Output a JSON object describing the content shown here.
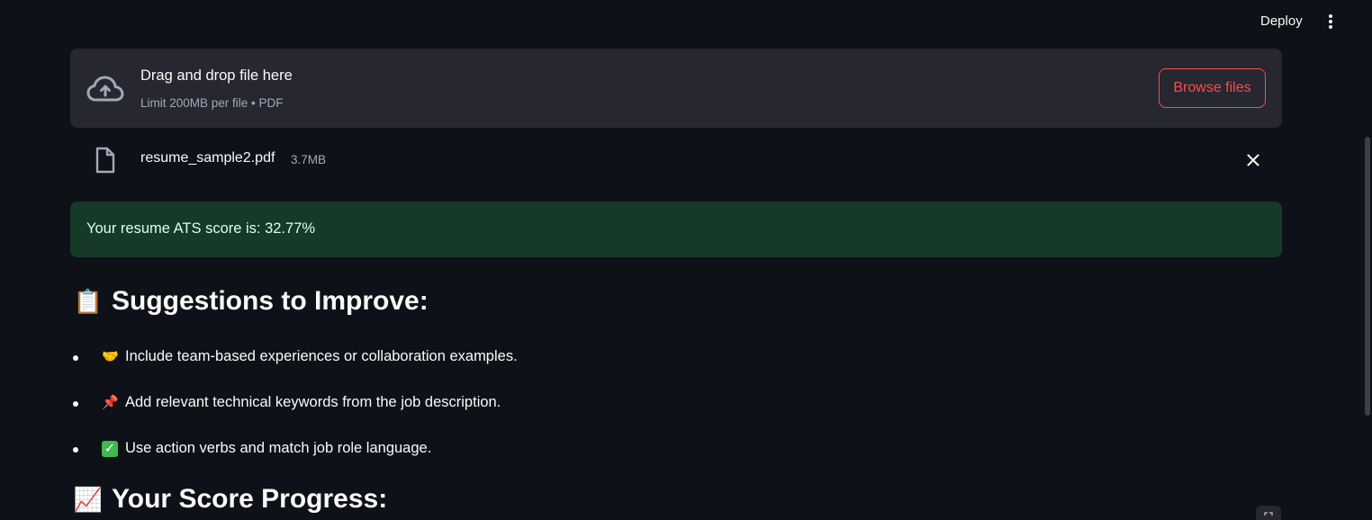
{
  "header": {
    "deploy_label": "Deploy",
    "menu_icon": "more-vertical-icon"
  },
  "uploader": {
    "title": "Drag and drop file here",
    "limit": "Limit 200MB per file • PDF",
    "browse_label": "Browse files",
    "icon": "cloud-upload-icon"
  },
  "file": {
    "name": "resume_sample2.pdf",
    "size": "3.7MB",
    "icon": "file-icon"
  },
  "score_alert": {
    "text": "Your resume ATS score is: 32.77%"
  },
  "suggestions": {
    "emoji": "📋",
    "title": "Suggestions to Improve:",
    "items": [
      {
        "emoji": "🤝",
        "text": "Include team-based experiences or collaboration examples."
      },
      {
        "emoji": "📌",
        "text": "Add relevant technical keywords from the job description."
      },
      {
        "emoji": "✓",
        "text": "Use action verbs and match job role language."
      }
    ]
  },
  "progress": {
    "emoji": "📈",
    "title": "Your Score Progress:"
  },
  "colors": {
    "background": "#0e1117",
    "panel": "#262730",
    "accent": "#ff4b4b",
    "success_bg": "#173928",
    "success_text": "#dffde9"
  }
}
